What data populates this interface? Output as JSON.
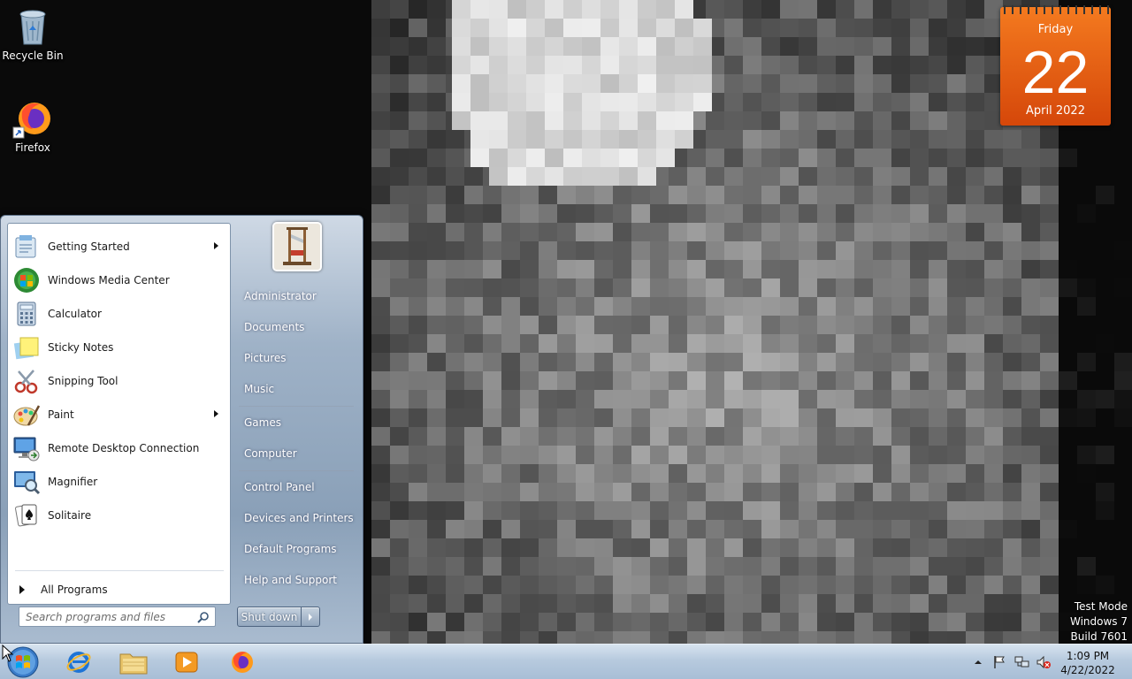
{
  "desktop": {
    "icons": [
      {
        "label": "Recycle Bin",
        "icon": "recycle-bin-icon"
      },
      {
        "label": "Firefox",
        "icon": "firefox-icon"
      }
    ],
    "watermark": {
      "line1": "Test Mode",
      "line2": "Windows 7",
      "line3": "Build 7601"
    }
  },
  "calendar": {
    "day": "Friday",
    "date": "22",
    "month": "April 2022",
    "color": "#e8621a"
  },
  "start_menu": {
    "programs": [
      {
        "label": "Getting Started",
        "icon": "getting-started-icon",
        "has_submenu": true
      },
      {
        "label": "Windows Media Center",
        "icon": "media-center-icon",
        "has_submenu": false
      },
      {
        "label": "Calculator",
        "icon": "calculator-icon",
        "has_submenu": false
      },
      {
        "label": "Sticky Notes",
        "icon": "sticky-notes-icon",
        "has_submenu": false
      },
      {
        "label": "Snipping Tool",
        "icon": "snipping-tool-icon",
        "has_submenu": false
      },
      {
        "label": "Paint",
        "icon": "paint-icon",
        "has_submenu": true
      },
      {
        "label": "Remote Desktop Connection",
        "icon": "remote-desktop-icon",
        "has_submenu": false
      },
      {
        "label": "Magnifier",
        "icon": "magnifier-icon",
        "has_submenu": false
      },
      {
        "label": "Solitaire",
        "icon": "solitaire-icon",
        "has_submenu": false
      }
    ],
    "all_programs": "All Programs",
    "search_placeholder": "Search programs and files",
    "right_items": [
      {
        "label": "Administrator"
      },
      {
        "label": "Documents"
      },
      {
        "label": "Pictures"
      },
      {
        "label": "Music"
      },
      {
        "label": "Games"
      },
      {
        "label": "Computer"
      },
      {
        "label": "Control Panel"
      },
      {
        "label": "Devices and Printers"
      },
      {
        "label": "Default Programs"
      },
      {
        "label": "Help and Support"
      }
    ],
    "shutdown_label": "Shut down"
  },
  "taskbar": {
    "pinned": [
      {
        "name": "Internet Explorer",
        "icon": "internet-explorer-icon"
      },
      {
        "name": "Windows Explorer",
        "icon": "explorer-folder-icon"
      },
      {
        "name": "Windows Media Player",
        "icon": "media-player-icon"
      },
      {
        "name": "Firefox",
        "icon": "firefox-icon"
      }
    ],
    "clock": {
      "time": "1:09 PM",
      "date": "4/22/2022"
    }
  }
}
